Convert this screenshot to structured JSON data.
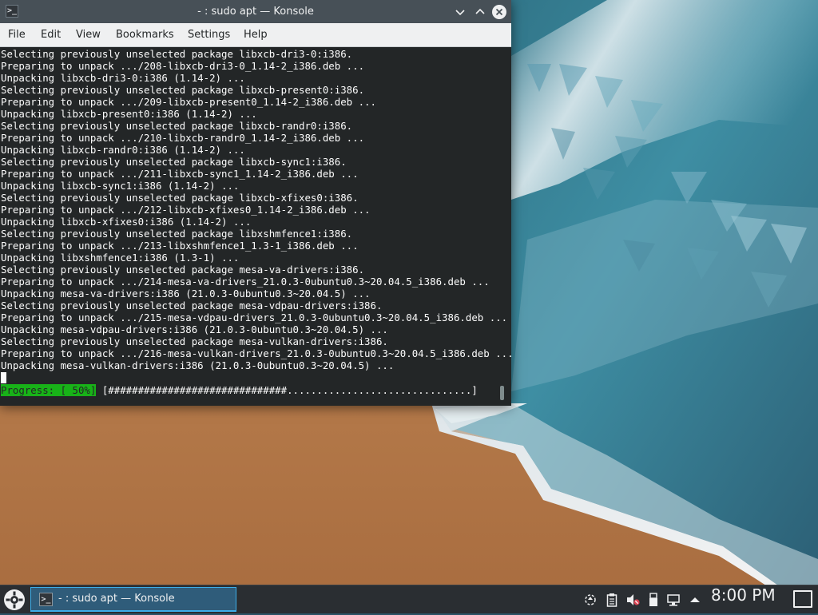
{
  "window": {
    "title": "- : sudo apt — Konsole",
    "app_icon": "terminal-icon"
  },
  "menubar": {
    "items": [
      "File",
      "Edit",
      "View",
      "Bookmarks",
      "Settings",
      "Help"
    ]
  },
  "terminal": {
    "lines": [
      "Selecting previously unselected package libxcb-dri3-0:i386.",
      "Preparing to unpack .../208-libxcb-dri3-0_1.14-2_i386.deb ...",
      "Unpacking libxcb-dri3-0:i386 (1.14-2) ...",
      "Selecting previously unselected package libxcb-present0:i386.",
      "Preparing to unpack .../209-libxcb-present0_1.14-2_i386.deb ...",
      "Unpacking libxcb-present0:i386 (1.14-2) ...",
      "Selecting previously unselected package libxcb-randr0:i386.",
      "Preparing to unpack .../210-libxcb-randr0_1.14-2_i386.deb ...",
      "Unpacking libxcb-randr0:i386 (1.14-2) ...",
      "Selecting previously unselected package libxcb-sync1:i386.",
      "Preparing to unpack .../211-libxcb-sync1_1.14-2_i386.deb ...",
      "Unpacking libxcb-sync1:i386 (1.14-2) ...",
      "Selecting previously unselected package libxcb-xfixes0:i386.",
      "Preparing to unpack .../212-libxcb-xfixes0_1.14-2_i386.deb ...",
      "Unpacking libxcb-xfixes0:i386 (1.14-2) ...",
      "Selecting previously unselected package libxshmfence1:i386.",
      "Preparing to unpack .../213-libxshmfence1_1.3-1_i386.deb ...",
      "Unpacking libxshmfence1:i386 (1.3-1) ...",
      "Selecting previously unselected package mesa-va-drivers:i386.",
      "Preparing to unpack .../214-mesa-va-drivers_21.0.3-0ubuntu0.3~20.04.5_i386.deb ...",
      "Unpacking mesa-va-drivers:i386 (21.0.3-0ubuntu0.3~20.04.5) ...",
      "Selecting previously unselected package mesa-vdpau-drivers:i386.",
      "Preparing to unpack .../215-mesa-vdpau-drivers_21.0.3-0ubuntu0.3~20.04.5_i386.deb ...",
      "Unpacking mesa-vdpau-drivers:i386 (21.0.3-0ubuntu0.3~20.04.5) ...",
      "Selecting previously unselected package mesa-vulkan-drivers:i386.",
      "Preparing to unpack .../216-mesa-vulkan-drivers_21.0.3-0ubuntu0.3~20.04.5_i386.deb ...",
      "Unpacking mesa-vulkan-drivers:i386 (21.0.3-0ubuntu0.3~20.04.5) ..."
    ],
    "progress_label": "Progress: [ 50%]",
    "progress_bar": "[##############################...............................]",
    "progress_percent": 50,
    "colors": {
      "background": "#232627",
      "foreground": "#fcfcfc",
      "progress_highlight": "#18b218"
    }
  },
  "taskbar": {
    "launcher_icon": "kde-application-launcher-icon",
    "task_label": "- : sudo apt — Konsole",
    "task_icon": "terminal-icon",
    "tray_icons": [
      "updates-icon",
      "clipboard-icon",
      "volume-muted-icon",
      "usb-device-icon",
      "network-wired-icon",
      "tray-expand-icon"
    ],
    "clock": "8:00 PM",
    "show_desktop_icon": "show-desktop-icon",
    "accent": "#3daee9"
  }
}
